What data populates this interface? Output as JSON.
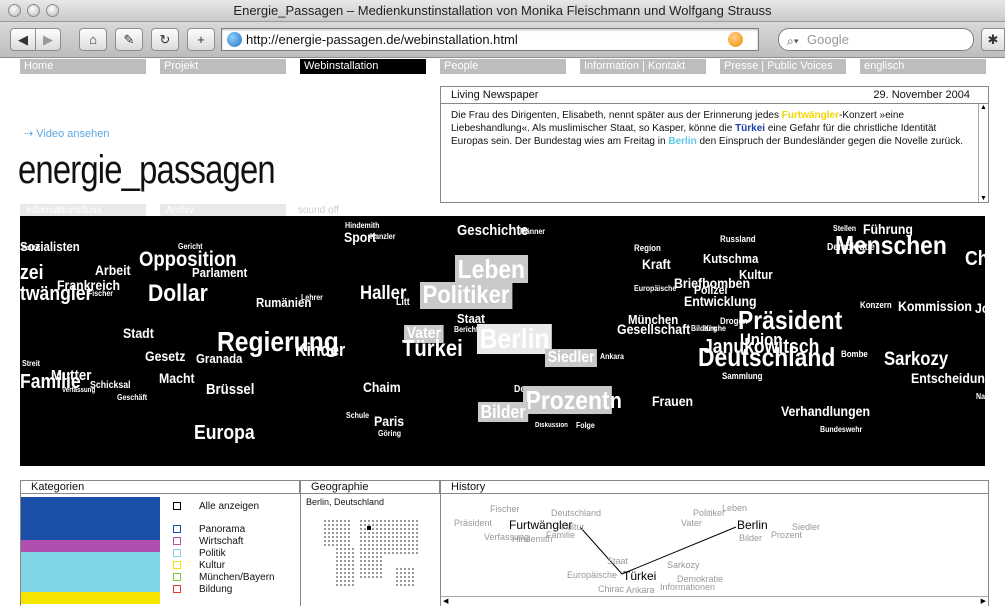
{
  "window": {
    "title": "Energie_Passagen – Medienkunstinstallation von Monika Fleischmann und Wolfgang Strauss"
  },
  "toolbar": {
    "url": "http://energie-passagen.de/webinstallation.html",
    "search_placeholder": "Google"
  },
  "nav": {
    "items": [
      {
        "label": "Home"
      },
      {
        "label": "Projekt"
      },
      {
        "label": "Webinstallation"
      },
      {
        "label": "People"
      },
      {
        "label": "Information | Kontakt"
      },
      {
        "label": "Presse | Public Voices"
      },
      {
        "label": "englisch"
      }
    ]
  },
  "header": {
    "video_link": "⇢ Video ansehen",
    "brand": "energie_passagen",
    "subtabs": [
      {
        "label": "Informationsfluss"
      },
      {
        "label": "Archiv"
      },
      {
        "label": "sound off"
      }
    ]
  },
  "newspaper": {
    "title": "Living Newspaper",
    "date": "29. November 2004",
    "segments": [
      {
        "text": "Die Frau des Dirigenten, Elisabeth, nennt später aus der Erinnerung jedes ",
        "style": ""
      },
      {
        "text": "Furtwängler",
        "style": "hl-yellow"
      },
      {
        "text": "-Konzert »eine Liebeshandlung«. Als muslimischer Staat, so Kasper, könne die ",
        "style": ""
      },
      {
        "text": "Türkei",
        "style": "hl-blue"
      },
      {
        "text": " eine Gefahr für die christliche Identität Europas sein. Der Bundestag wies am Freitag in ",
        "style": ""
      },
      {
        "text": "Berlin",
        "style": "hl-cyan"
      },
      {
        "text": " den Einspruch der Bundesländer gegen die Novelle zurück.",
        "style": ""
      }
    ]
  },
  "cloud": {
    "words": [
      {
        "t": "Sozialisten"
      },
      {
        "t": "Politik"
      },
      {
        "t": "zei"
      },
      {
        "t": "Arbeit"
      },
      {
        "t": "Frankreich"
      },
      {
        "t": "twängler"
      },
      {
        "t": "Fischer"
      },
      {
        "t": "Gericht"
      },
      {
        "t": "Opposition"
      },
      {
        "t": "Parlament"
      },
      {
        "t": "Dollar"
      },
      {
        "t": "Rumänien"
      },
      {
        "t": "Lehrer"
      },
      {
        "t": "Stadt"
      },
      {
        "t": "Regierung"
      },
      {
        "t": "Kinder"
      },
      {
        "t": "Gesetz"
      },
      {
        "t": "Granada"
      },
      {
        "t": "Streit"
      },
      {
        "t": "Mutter"
      },
      {
        "t": "Familie"
      },
      {
        "t": "Verfassung"
      },
      {
        "t": "Schicksal"
      },
      {
        "t": "Geschäft"
      },
      {
        "t": "Macht"
      },
      {
        "t": "Brüssel"
      },
      {
        "t": "Europa"
      },
      {
        "t": "Hindemith"
      },
      {
        "t": "Sport"
      },
      {
        "t": "Kanzler"
      },
      {
        "t": "Geschichte"
      },
      {
        "t": "Männer"
      },
      {
        "t": "Haller"
      },
      {
        "t": "Litt"
      },
      {
        "t": "Leben"
      },
      {
        "t": "Politiker"
      },
      {
        "t": "Staat"
      },
      {
        "t": "Bericht"
      },
      {
        "t": "Vater"
      },
      {
        "t": "Türkei"
      },
      {
        "t": "Berlin"
      },
      {
        "t": "Siedler"
      },
      {
        "t": "Ankara"
      },
      {
        "t": "Chaim"
      },
      {
        "t": "Schule"
      },
      {
        "t": "Paris"
      },
      {
        "t": "Göring"
      },
      {
        "t": "De"
      },
      {
        "t": "Prozent"
      },
      {
        "t": "n"
      },
      {
        "t": "Bilder"
      },
      {
        "t": "Diskussion"
      },
      {
        "t": "Folge"
      },
      {
        "t": "Region"
      },
      {
        "t": "Kraft"
      },
      {
        "t": "Russland"
      },
      {
        "t": "Kutschma"
      },
      {
        "t": "Kultur"
      },
      {
        "t": "Europäische"
      },
      {
        "t": "Briefbomben"
      },
      {
        "t": "Polizei"
      },
      {
        "t": "Entwicklung"
      },
      {
        "t": "München"
      },
      {
        "t": "Gesellschaft"
      },
      {
        "t": "Bildung"
      },
      {
        "t": "Kirche"
      },
      {
        "t": "Drogen"
      },
      {
        "t": "Präsident"
      },
      {
        "t": "Union"
      },
      {
        "t": "Janukowitsch"
      },
      {
        "t": "Deutschland"
      },
      {
        "t": "Sammlung"
      },
      {
        "t": "Frauen"
      },
      {
        "t": "Stellen"
      },
      {
        "t": "Führung"
      },
      {
        "t": "Demokratie"
      },
      {
        "t": "Menschen"
      },
      {
        "t": "Ch"
      },
      {
        "t": "Konzern"
      },
      {
        "t": "Kommission"
      },
      {
        "t": "Bombe"
      },
      {
        "t": "Sarkozy"
      },
      {
        "t": "Entscheidung"
      },
      {
        "t": "Verhandlungen"
      },
      {
        "t": "Bundeswehr"
      },
      {
        "t": "Na"
      },
      {
        "t": "Jo"
      }
    ]
  },
  "panels": {
    "kategorien": {
      "title": "Kategorien",
      "items": [
        {
          "label": "Alle anzeigen",
          "color": "#000000"
        },
        {
          "label": "Panorama",
          "color": "#1b4fa8"
        },
        {
          "label": "Wirtschaft",
          "color": "#b04fb0"
        },
        {
          "label": "Politik",
          "color": "#7fd4e6"
        },
        {
          "label": "Kultur",
          "color": "#f5e400"
        },
        {
          "label": "München/Bayern",
          "color": "#7ac943"
        },
        {
          "label": "Bildung",
          "color": "#e8342a"
        }
      ],
      "bars": [
        {
          "color": "#1b4fa8"
        },
        {
          "color": "#b04fb0"
        },
        {
          "color": "#7fd4e6"
        },
        {
          "color": "#f5e400"
        }
      ]
    },
    "geographie": {
      "title": "Geographie",
      "place": "Berlin, Deutschland"
    },
    "history": {
      "title": "History",
      "terms": [
        {
          "t": "Fischer"
        },
        {
          "t": "Deutschland"
        },
        {
          "t": "Präsident"
        },
        {
          "t": "Furtwängler"
        },
        {
          "t": "Kultur"
        },
        {
          "t": "Verfassung"
        },
        {
          "t": "Hindemith"
        },
        {
          "t": "Familie"
        },
        {
          "t": "Politiker"
        },
        {
          "t": "Leben"
        },
        {
          "t": "Vater"
        },
        {
          "t": "Berlin"
        },
        {
          "t": "Siedler"
        },
        {
          "t": "Bilder"
        },
        {
          "t": "Prozent"
        },
        {
          "t": "Staat"
        },
        {
          "t": "Sarkozy"
        },
        {
          "t": "Europäische"
        },
        {
          "t": "Türkei"
        },
        {
          "t": "Demokratie"
        },
        {
          "t": "Chirac"
        },
        {
          "t": "Ankara"
        },
        {
          "t": "Informationen"
        }
      ]
    }
  }
}
